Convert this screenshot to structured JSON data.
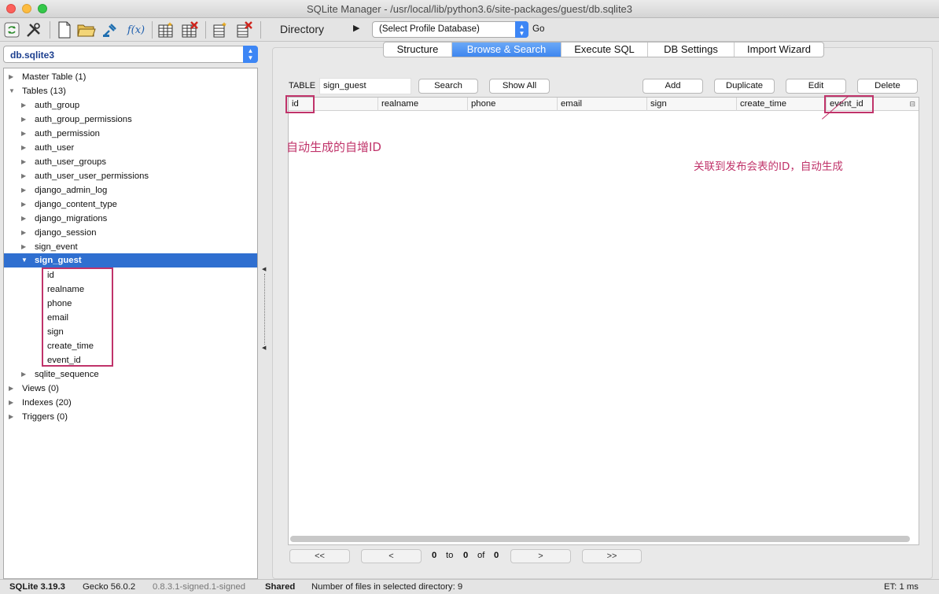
{
  "window": {
    "title": "SQLite Manager - /usr/local/lib/python3.6/site-packages/guest/db.sqlite3"
  },
  "toolbar": {
    "icons": [
      "refresh-icon",
      "tools-icon",
      "new-file-icon",
      "open-folder-icon",
      "connect-icon",
      "function-icon",
      "create-table-icon",
      "drop-table-icon",
      "create-index-icon",
      "drop-index-icon"
    ],
    "function_label": "f(x)",
    "directory_label": "Directory",
    "profile_select": "(Select Profile Database)",
    "go_label": "Go"
  },
  "sidebar": {
    "db_select": "db.sqlite3",
    "tree": {
      "master": "Master Table (1)",
      "tables": "Tables (13)",
      "table_items": [
        "auth_group",
        "auth_group_permissions",
        "auth_permission",
        "auth_user",
        "auth_user_groups",
        "auth_user_user_permissions",
        "django_admin_log",
        "django_content_type",
        "django_migrations",
        "django_session",
        "sign_event"
      ],
      "selected": "sign_guest",
      "columns": [
        "id",
        "realname",
        "phone",
        "email",
        "sign",
        "create_time",
        "event_id"
      ],
      "sqlite_sequence": "sqlite_sequence",
      "views": "Views (0)",
      "indexes": "Indexes (20)",
      "triggers": "Triggers (0)"
    }
  },
  "tabs": [
    "Structure",
    "Browse & Search",
    "Execute SQL",
    "DB Settings",
    "Import Wizard"
  ],
  "browse": {
    "table_label": "TABLE",
    "table_value": "sign_guest",
    "buttons": {
      "search": "Search",
      "show_all": "Show All",
      "add": "Add",
      "duplicate": "Duplicate",
      "edit": "Edit",
      "delete": "Delete"
    },
    "columns": [
      "id",
      "realname",
      "phone",
      "email",
      "sign",
      "create_time",
      "event_id"
    ]
  },
  "annotations": {
    "auto_id": "自动生成的自增ID",
    "event_ref": "关联到发布会表的ID，自动生成"
  },
  "pager": {
    "first": "<<",
    "prev": "<",
    "from": "0",
    "to_label": "to",
    "to": "0",
    "of_label": "of",
    "total": "0",
    "next": ">",
    "last": ">>"
  },
  "status": {
    "sqlite": "SQLite 3.19.3",
    "gecko": "Gecko 56.0.2",
    "version": "0.8.3.1-signed.1-signed",
    "shared": "Shared",
    "files": "Number of files in selected directory: 9",
    "et": "ET: 1 ms"
  },
  "colors": {
    "annotation": "#c0336a",
    "selection": "#2f6fd0",
    "accent": "#3d86f5"
  }
}
